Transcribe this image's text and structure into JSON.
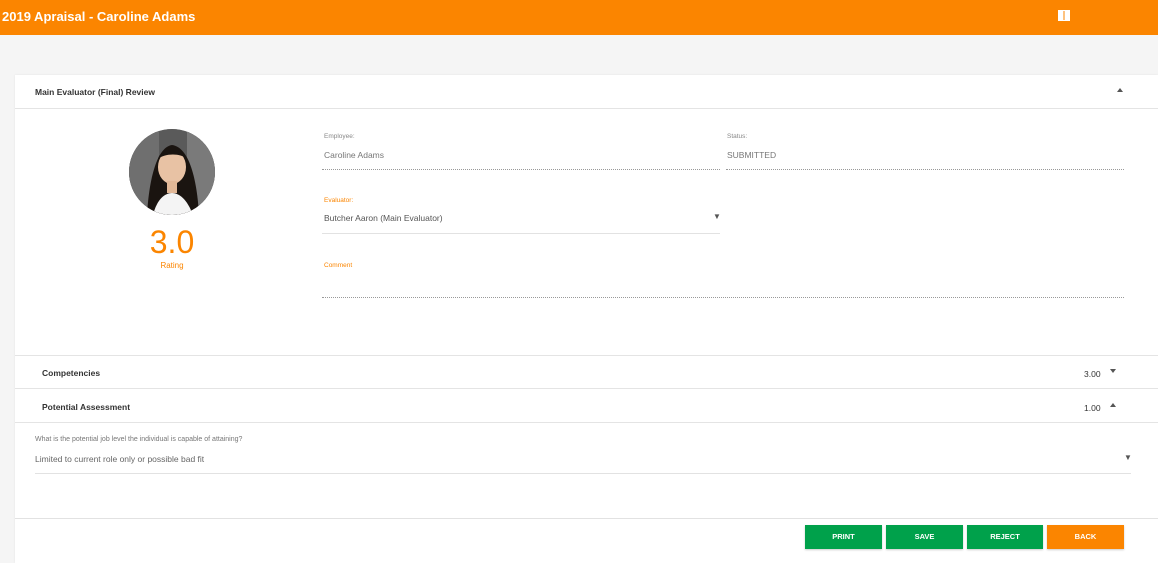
{
  "header": {
    "title": "2019 Apraisal - Caroline Adams",
    "icon": "book-icon",
    "bg_color": "#fb8500"
  },
  "main_review": {
    "section_title": "Main Evaluator (Final) Review",
    "rating_value": "3.0",
    "rating_label": "Rating",
    "employee_label": "Employee:",
    "employee_value": "Caroline Adams",
    "status_label": "Status:",
    "status_value": "SUBMITTED",
    "evaluator_label": "Evaluator:",
    "evaluator_value": "Butcher Aaron (Main Evaluator)",
    "comment_label": "Comment"
  },
  "competencies": {
    "label": "Competencies",
    "score": "3.00"
  },
  "potential": {
    "label": "Potential Assessment",
    "score": "1.00",
    "question": "What is the potential job level the individual is capable of attaining?",
    "answer": "Limited to current role only or possible bad fit"
  },
  "buttons": {
    "print": "PRINT",
    "save": "SAVE",
    "reject": "REJECT",
    "back": "BACK"
  },
  "colors": {
    "accent": "#fb8500",
    "button_green": "#00a14b"
  }
}
